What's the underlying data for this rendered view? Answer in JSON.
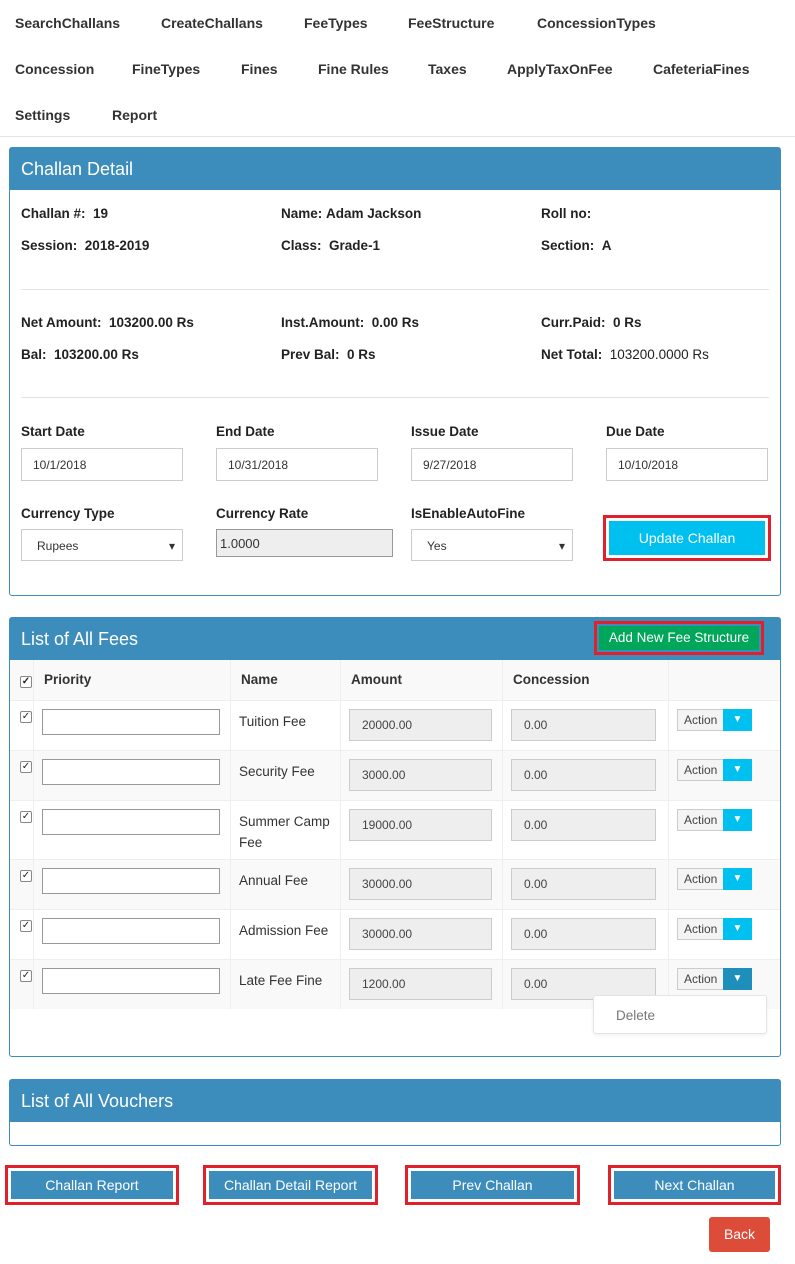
{
  "nav": [
    "SearchChallans",
    "CreateChallans",
    "FeeTypes",
    "FeeStructure",
    "ConcessionTypes",
    "Concession",
    "FineTypes",
    "Fines",
    "Fine Rules",
    "Taxes",
    "ApplyTaxOnFee",
    "CafeteriaFines",
    "Settings",
    "Report"
  ],
  "challan": {
    "title": "Challan Detail",
    "challan_no_label": "Challan #:",
    "challan_no": "19",
    "name_label": "Name:",
    "name": "Adam Jackson",
    "roll_label": "Roll no:",
    "roll": "",
    "session_label": "Session:",
    "session": "2018-2019",
    "class_label": "Class:",
    "class": "Grade-1",
    "section_label": "Section:",
    "section": "A",
    "net_amount_label": "Net Amount:",
    "net_amount": "103200.00 Rs",
    "inst_amount_label": "Inst.Amount:",
    "inst_amount": "0.00 Rs",
    "curr_paid_label": "Curr.Paid:",
    "curr_paid": "0 Rs",
    "bal_label": "Bal:",
    "bal": "103200.00 Rs",
    "prev_bal_label": "Prev Bal:",
    "prev_bal": "0 Rs",
    "net_total_label": "Net Total:",
    "net_total": "103200.0000 Rs",
    "start_date_label": "Start Date",
    "start_date": "10/1/2018",
    "end_date_label": "End Date",
    "end_date": "10/31/2018",
    "issue_date_label": "Issue Date",
    "issue_date": "9/27/2018",
    "due_date_label": "Due Date",
    "due_date": "10/10/2018",
    "currency_type_label": "Currency Type",
    "currency_type": "Rupees",
    "currency_rate_label": "Currency Rate",
    "currency_rate": "1.0000",
    "auto_fine_label": "IsEnableAutoFine",
    "auto_fine": "Yes",
    "update_button": "Update Challan"
  },
  "fees": {
    "title": "List of All Fees",
    "add_button": "Add New Fee Structure",
    "headers": {
      "priority": "Priority",
      "name": "Name",
      "amount": "Amount",
      "concession": "Concession"
    },
    "rows": [
      {
        "name": "Tuition Fee",
        "amount": "20000.00",
        "concession": "0.00",
        "action": "Action"
      },
      {
        "name": "Security Fee",
        "amount": "3000.00",
        "concession": "0.00",
        "action": "Action"
      },
      {
        "name": "Summer Camp Fee",
        "amount": "19000.00",
        "concession": "0.00",
        "action": "Action"
      },
      {
        "name": "Annual Fee",
        "amount": "30000.00",
        "concession": "0.00",
        "action": "Action"
      },
      {
        "name": "Admission Fee",
        "amount": "30000.00",
        "concession": "0.00",
        "action": "Action"
      },
      {
        "name": "Late Fee Fine",
        "amount": "1200.00",
        "concession": "0.00",
        "action": "Action"
      }
    ],
    "dropdown_delete": "Delete"
  },
  "vouchers": {
    "title": "List of All Vouchers"
  },
  "buttons": {
    "challan_report": "Challan Report",
    "challan_detail_report": "Challan Detail Report",
    "prev_challan": "Prev Challan",
    "next_challan": "Next Challan",
    "back": "Back"
  }
}
